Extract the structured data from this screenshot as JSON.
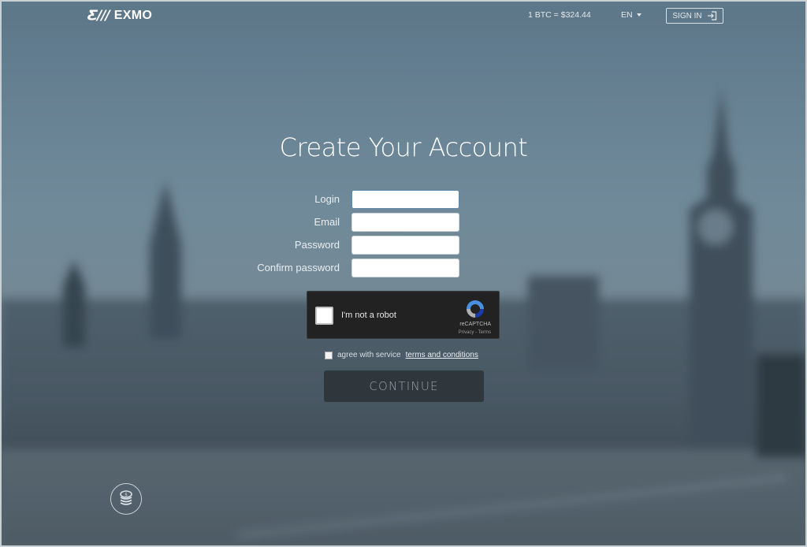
{
  "header": {
    "logo_mark": "Ƹ///",
    "brand": "EXMO",
    "rate": "1 BTC = $324.44",
    "language": "EN",
    "sign_in_label": "SIGN IN"
  },
  "page": {
    "title": "Create Your Account"
  },
  "form": {
    "fields": [
      {
        "label": "Login",
        "value": "",
        "placeholder": ""
      },
      {
        "label": "Email",
        "value": "",
        "placeholder": ""
      },
      {
        "label": "Password",
        "value": "",
        "placeholder": ""
      },
      {
        "label": "Confirm password",
        "value": "",
        "placeholder": ""
      }
    ],
    "captcha": {
      "label": "I'm not a robot",
      "brand": "reCAPTCHA",
      "links": "Privacy - Terms"
    },
    "agree": {
      "text": "agree with service",
      "link": "terms and conditions",
      "checked": false
    },
    "submit_label": "CONTINUE"
  },
  "icons": {
    "signin": "sign-in-icon",
    "language_caret": "caret-down-icon",
    "coins": "coin-stack-icon",
    "captcha_logo": "recaptcha-logo-icon"
  }
}
